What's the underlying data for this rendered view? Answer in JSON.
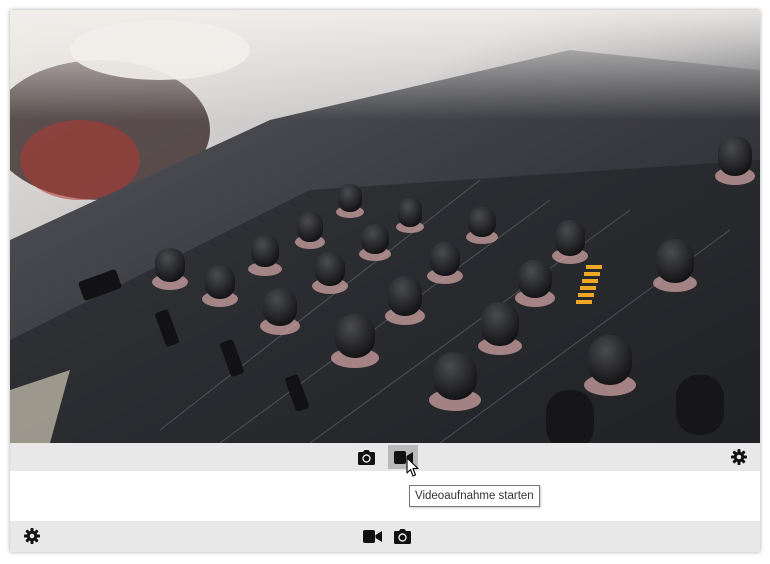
{
  "image": {
    "description_icon": "audio-mixer-photo"
  },
  "top_toolbar": {
    "buttons": [
      {
        "icon": "camera-icon"
      },
      {
        "icon": "video-camera-icon",
        "state": "hovered"
      },
      {
        "icon": "gear-icon"
      }
    ]
  },
  "tooltip": {
    "text": "Videoaufnahme starten"
  },
  "bottom_toolbar": {
    "buttons": [
      {
        "icon": "gear-icon"
      },
      {
        "icon": "video-camera-icon"
      },
      {
        "icon": "camera-icon"
      }
    ]
  },
  "colors": {
    "toolbar_bg": "#e8e8e8",
    "hover_bg": "#b9b9b9",
    "icon": "#111111"
  }
}
